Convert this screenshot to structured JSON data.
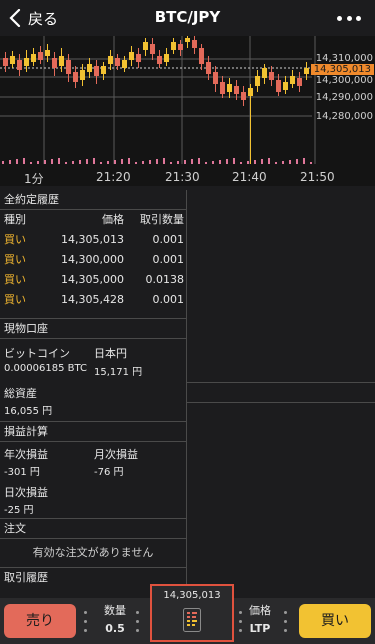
{
  "header": {
    "back_label": "戻る",
    "title": "BTC/JPY"
  },
  "chart": {
    "interval_label": "1分",
    "time_labels": [
      "21:20",
      "21:30",
      "21:40",
      "21:50"
    ],
    "price_labels": [
      "14,310,000",
      "14,300,000",
      "14,290,000",
      "14,280,000"
    ],
    "current_price": "14,305,013",
    "colors": {
      "up": "#f2c232",
      "down": "#e36a5a"
    }
  },
  "trades": {
    "title": "全約定履歴",
    "headers": {
      "side": "種別",
      "price": "価格",
      "qty": "取引数量"
    },
    "rows": [
      {
        "side": "買い",
        "price": "14,305,013",
        "qty": "0.001"
      },
      {
        "side": "買い",
        "price": "14,300,000",
        "qty": "0.001"
      },
      {
        "side": "買い",
        "price": "14,305,000",
        "qty": "0.0138"
      },
      {
        "side": "買い",
        "price": "14,305,428",
        "qty": "0.001"
      }
    ]
  },
  "spot": {
    "title": "現物口座",
    "btc_label": "ビットコイン",
    "btc_value": "0.00006185 BTC",
    "jpy_label": "日本円",
    "jpy_value": "15,171 円",
    "total_label": "総資産",
    "total_value": "16,055 円"
  },
  "pnl": {
    "title": "損益計算",
    "yearly_label": "年次損益",
    "yearly_value": "-301 円",
    "monthly_label": "月次損益",
    "monthly_value": "-76 円",
    "daily_label": "日次損益",
    "daily_value": "-25 円"
  },
  "orders": {
    "title": "注文",
    "empty_text": "有効な注文がありません"
  },
  "history": {
    "title": "取引履歴"
  },
  "bottom": {
    "sell_label": "売り",
    "qty_label": "数量",
    "qty_value": "0.5",
    "center_price": "14,305,013",
    "price_label": "価格",
    "price_type": "LTP",
    "buy_label": "買い"
  }
}
